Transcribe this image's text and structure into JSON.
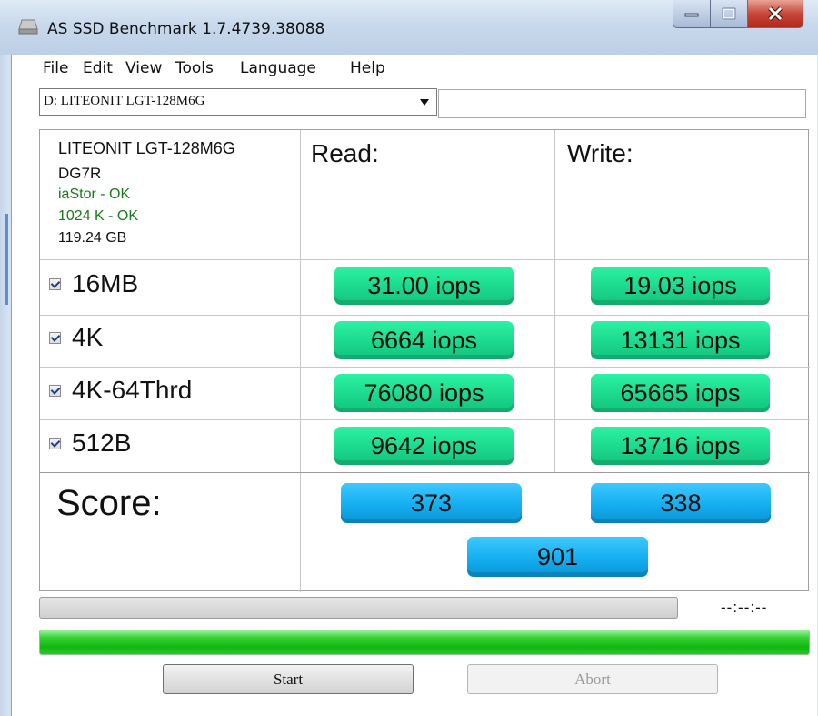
{
  "window": {
    "title": "AS SSD Benchmark 1.7.4739.38088"
  },
  "menu": [
    "File",
    "Edit",
    "View",
    "Tools",
    "Language",
    "Help"
  ],
  "drive": {
    "selected": "D: LITEONIT LGT-128M6G"
  },
  "device": {
    "model": "LITEONIT LGT-128M6G",
    "firmware": "DG7R",
    "driver": "iaStor - OK",
    "alignment": "1024 K - OK",
    "size": "119.24 GB"
  },
  "columns": {
    "read": "Read:",
    "write": "Write:"
  },
  "tests": [
    {
      "name": "16MB",
      "checked": true,
      "read": "31.00 iops",
      "write": "19.03 iops"
    },
    {
      "name": "4K",
      "checked": true,
      "read": "6664 iops",
      "write": "13131 iops"
    },
    {
      "name": "4K-64Thrd",
      "checked": true,
      "read": "76080 iops",
      "write": "65665 iops"
    },
    {
      "name": "512B",
      "checked": true,
      "read": "9642 iops",
      "write": "13716 iops"
    }
  ],
  "score": {
    "label": "Score:",
    "read": "373",
    "write": "338",
    "total": "901"
  },
  "progress": {
    "time": "--:--:--",
    "completed_fraction": 1.0
  },
  "buttons": {
    "start": "Start",
    "abort": "Abort"
  },
  "colors": {
    "ok_text": "#1a7a1a",
    "result_green": "#1bd98e",
    "score_blue": "#14aef0",
    "progress_green": "#10b810"
  },
  "icons": [
    "drive-icon",
    "minimize-icon",
    "maximize-icon",
    "close-icon",
    "dropdown-arrow-icon",
    "checkbox-checked-icon"
  ]
}
